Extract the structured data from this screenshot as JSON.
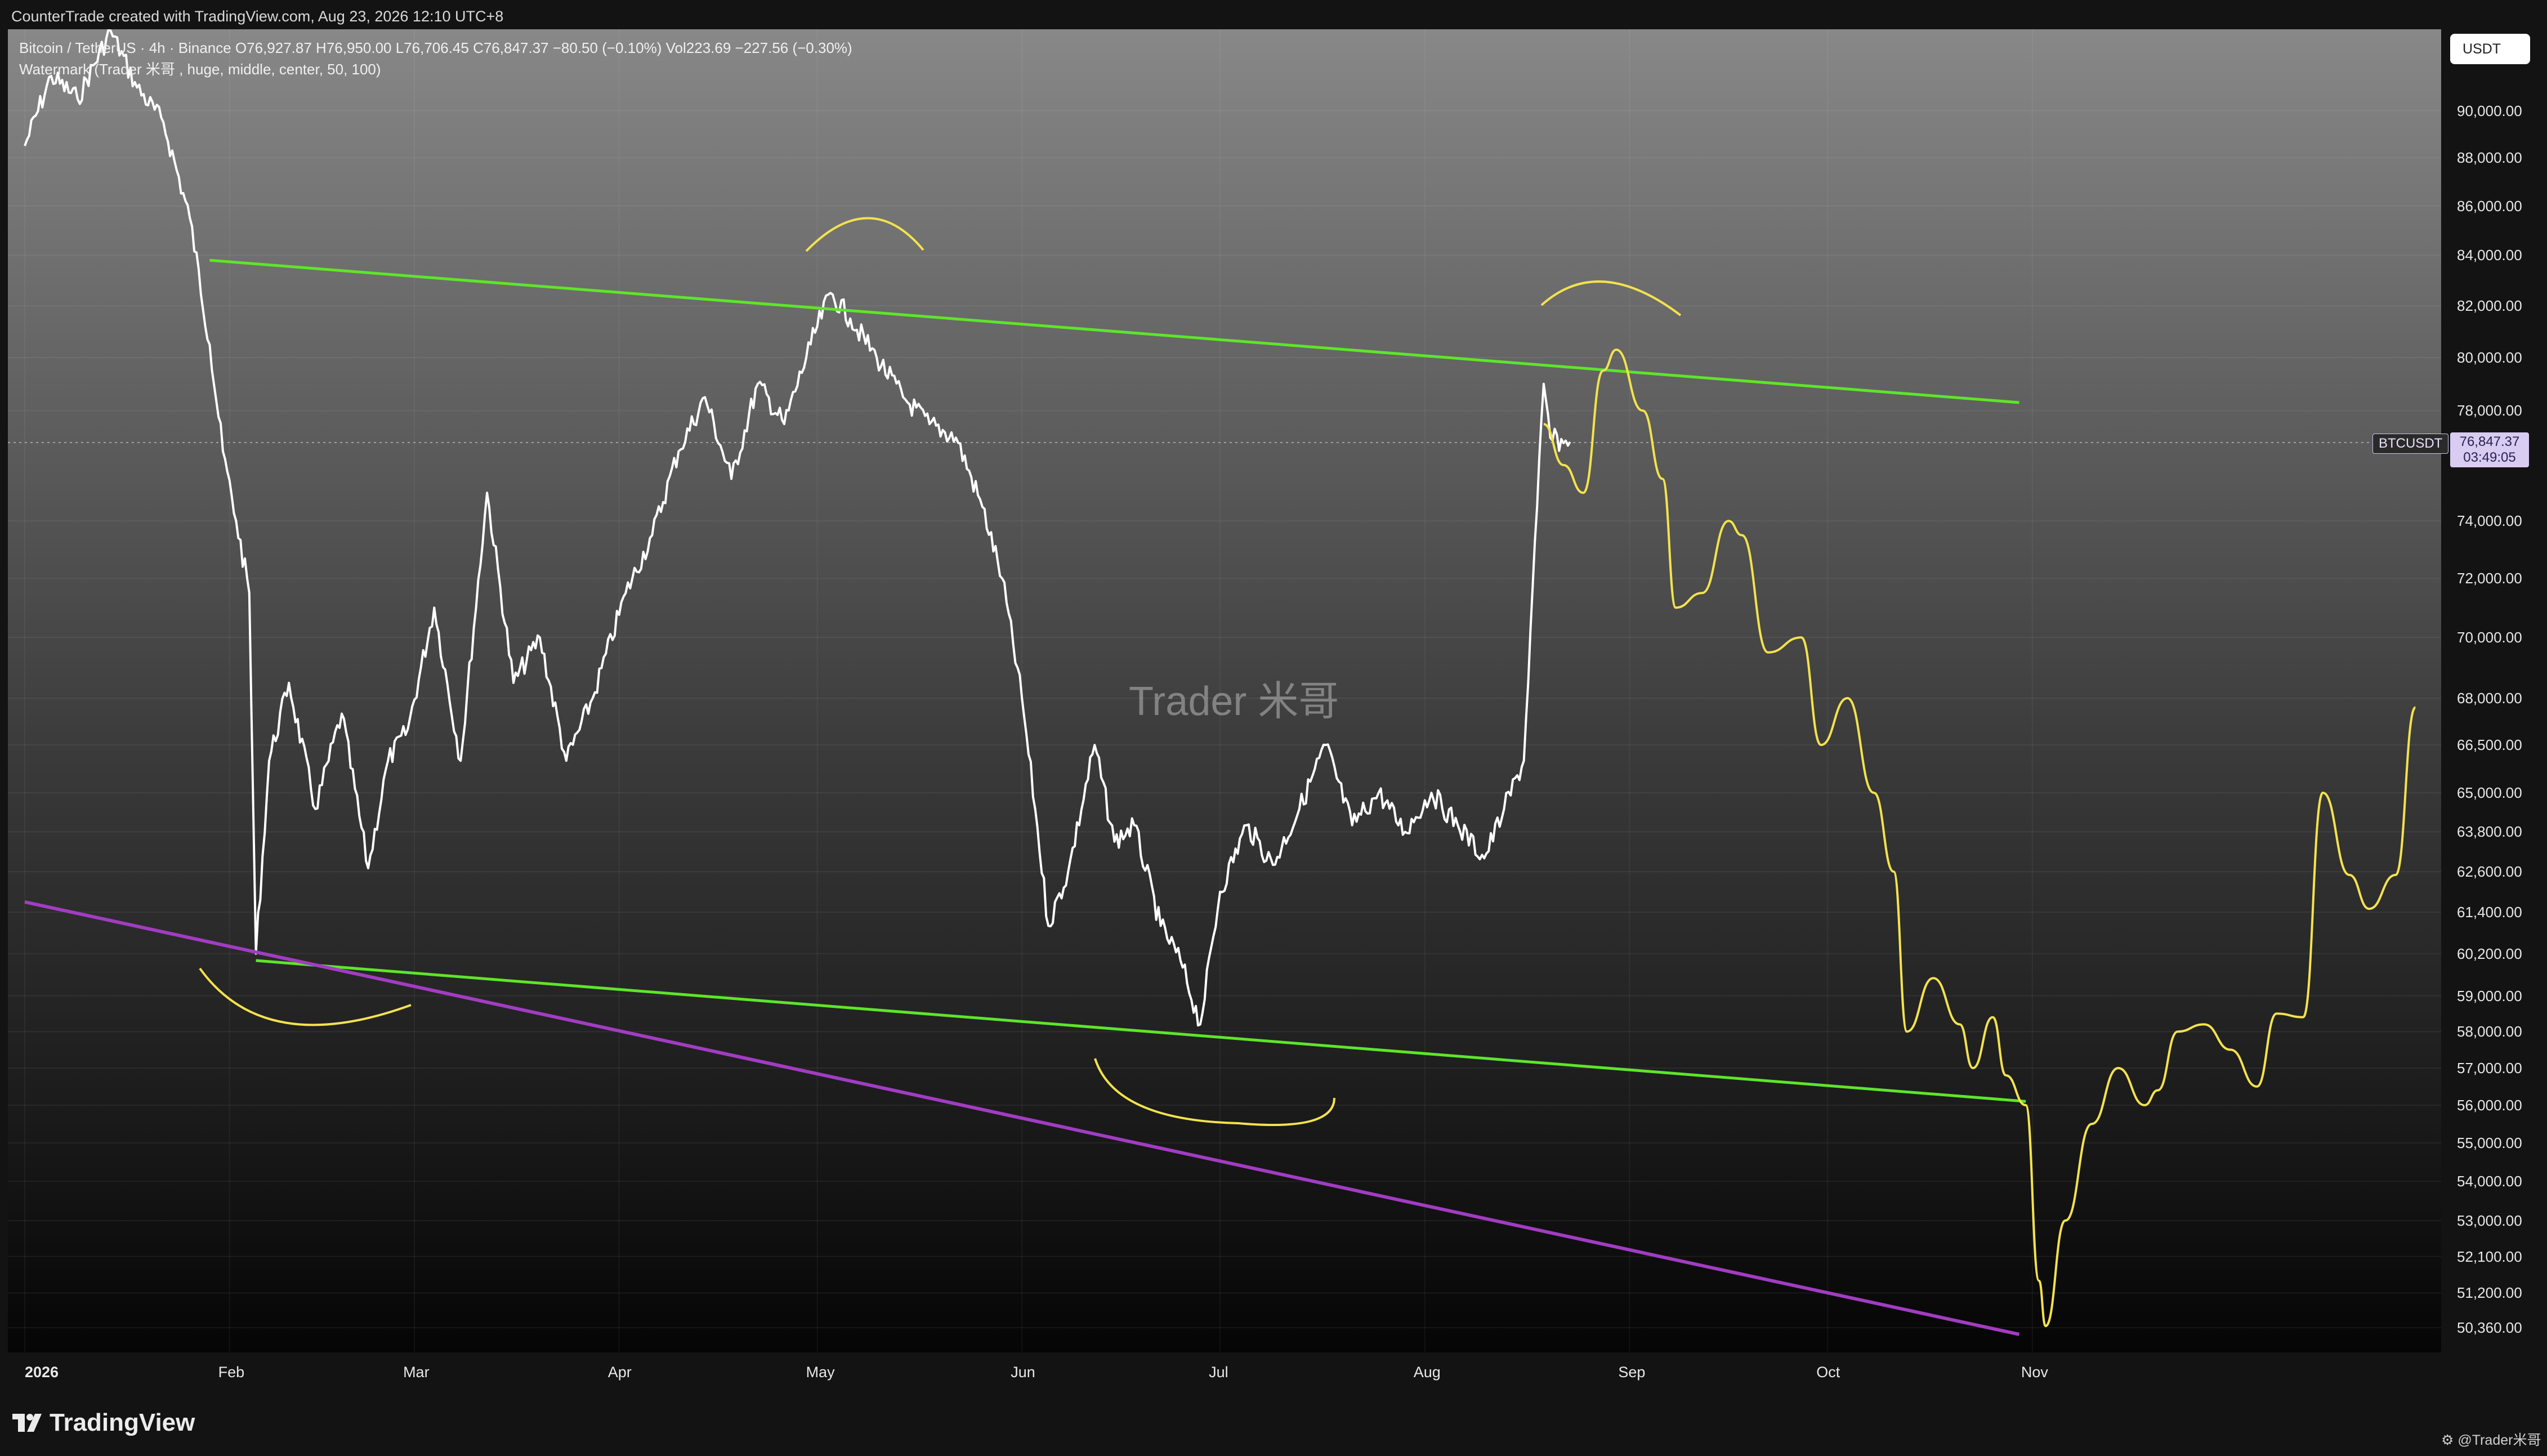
{
  "header": {
    "created_by": "CounterTrade created with TradingView.com, Aug 23, 2026 12:10 UTC+8"
  },
  "legend": {
    "symbol_line": "Bitcoin / TetherUS · 4h · Binance  O76,927.87  H76,950.00  L76,706.45  C76,847.37  −80.50 (−0.10%)  Vol223.69  −227.56 (−0.30%)",
    "indicator_line": "Watermark (Trader 米哥 , huge, middle, center, 50, 100)"
  },
  "toolbar": {
    "currency": "USDT"
  },
  "watermark": {
    "text": "Trader 米哥"
  },
  "price_marker": {
    "symbol": "BTCUSDT",
    "price": "76,847.37",
    "countdown": "03:49:05"
  },
  "brand": {
    "name": "TradingView"
  },
  "credit": {
    "text": "@Trader米哥"
  },
  "colors": {
    "price_line": "#ffffff",
    "green_trendline": "#5ee52a",
    "purple_trendline": "#a23cc2",
    "yellow_drawing": "#f3e24e",
    "marker_bg": "#d8ccf2"
  },
  "icons": [
    "tradingview-logo-icon",
    "snapshot-icon"
  ],
  "chart_data": {
    "type": "line",
    "symbol": "BTCUSDT",
    "interval": "4h",
    "exchange": "Binance",
    "scale": "log",
    "grid": true,
    "ylim": [
      50000,
      95000
    ],
    "xlim": [
      "2026-01-01",
      "2026-12-01"
    ],
    "x_ticks": [
      "2026",
      "Feb",
      "Mar",
      "Apr",
      "May",
      "Jun",
      "Jul",
      "Aug",
      "Sep",
      "Oct",
      "Nov"
    ],
    "y_ticks": [
      "90,000.00",
      "88,000.00",
      "86,000.00",
      "84,000.00",
      "82,000.00",
      "80,000.00",
      "78,000.00",
      "74,000.00",
      "72,000.00",
      "70,000.00",
      "68,000.00",
      "66,500.00",
      "65,000.00",
      "63,800.00",
      "62,600.00",
      "61,400.00",
      "60,200.00",
      "59,000.00",
      "58,000.00",
      "57,000.00",
      "56,000.00",
      "55,000.00",
      "54,000.00",
      "53,000.00",
      "52,100.00",
      "51,200.00",
      "50,360.00"
    ],
    "series": [
      {
        "x": [
          "2026-01-01",
          "2026-01-05",
          "2026-01-09",
          "2026-01-14",
          "2026-01-18",
          "2026-01-22",
          "2026-01-26",
          "2026-01-29",
          "2026-01-31",
          "2026-02-02",
          "2026-02-04",
          "2026-02-05",
          "2026-02-07",
          "2026-02-10",
          "2026-02-14",
          "2026-02-18",
          "2026-02-22",
          "2026-02-25",
          "2026-02-28",
          "2026-03-04",
          "2026-03-08",
          "2026-03-12",
          "2026-03-16",
          "2026-03-20",
          "2026-03-24",
          "2026-03-28",
          "2026-04-02",
          "2026-04-06",
          "2026-04-10",
          "2026-04-14",
          "2026-04-18",
          "2026-04-22",
          "2026-04-26",
          "2026-04-30",
          "2026-05-03",
          "2026-05-06",
          "2026-05-10",
          "2026-05-14",
          "2026-05-18",
          "2026-05-22",
          "2026-05-26",
          "2026-05-29",
          "2026-06-01",
          "2026-06-03",
          "2026-06-05",
          "2026-06-08",
          "2026-06-12",
          "2026-06-15",
          "2026-06-18",
          "2026-06-22",
          "2026-06-25",
          "2026-06-28",
          "2026-07-01",
          "2026-07-05",
          "2026-07-09",
          "2026-07-13",
          "2026-07-17",
          "2026-07-21",
          "2026-07-25",
          "2026-07-29",
          "2026-08-02",
          "2026-08-06",
          "2026-08-10",
          "2026-08-13",
          "2026-08-16",
          "2026-08-18",
          "2026-08-19",
          "2026-08-20",
          "2026-08-22",
          "2026-08-23"
        ],
        "y": [
          88500,
          91500,
          90500,
          93500,
          91000,
          89500,
          85500,
          80500,
          76500,
          74000,
          71500,
          60200,
          66000,
          68500,
          64500,
          67500,
          62700,
          66000,
          67000,
          71000,
          66000,
          75000,
          68500,
          70000,
          66000,
          68000,
          71500,
          73500,
          76500,
          78500,
          75500,
          79000,
          77500,
          80500,
          82500,
          81500,
          80000,
          78500,
          77500,
          77000,
          74500,
          72000,
          68000,
          64500,
          61000,
          62600,
          66500,
          63500,
          64000,
          61000,
          60000,
          58200,
          62000,
          64000,
          62800,
          64500,
          66500,
          64000,
          65000,
          63800,
          65000,
          64000,
          63000,
          64500,
          66000,
          74500,
          79000,
          77000,
          76800,
          76847
        ]
      }
    ],
    "annotations": {
      "green_upper_trendline": [
        [
          "2026-01-29",
          83800
        ],
        [
          "2026-10-30",
          78300
        ]
      ],
      "green_lower_trendline": [
        [
          "2026-02-05",
          60000
        ],
        [
          "2026-10-31",
          56100
        ]
      ],
      "purple_trendline": [
        [
          "2026-01-01",
          61700
        ],
        [
          "2026-10-30",
          50200
        ]
      ],
      "yellow_projection": [
        [
          "2026-08-19",
          77500
        ],
        [
          "2026-08-22",
          76000
        ],
        [
          "2026-08-25",
          75000
        ],
        [
          "2026-08-28",
          79500
        ],
        [
          "2026-08-30",
          80300
        ],
        [
          "2026-09-03",
          78000
        ],
        [
          "2026-09-06",
          75500
        ],
        [
          "2026-09-08",
          71000
        ],
        [
          "2026-09-12",
          71500
        ],
        [
          "2026-09-16",
          74000
        ],
        [
          "2026-09-18",
          73500
        ],
        [
          "2026-09-22",
          69500
        ],
        [
          "2026-09-27",
          70000
        ],
        [
          "2026-09-30",
          66500
        ],
        [
          "2026-10-04",
          68000
        ],
        [
          "2026-10-08",
          65000
        ],
        [
          "2026-10-11",
          62600
        ],
        [
          "2026-10-13",
          58000
        ],
        [
          "2026-10-17",
          59500
        ],
        [
          "2026-10-21",
          58200
        ],
        [
          "2026-10-23",
          57000
        ],
        [
          "2026-10-26",
          58400
        ],
        [
          "2026-10-28",
          56800
        ],
        [
          "2026-10-31",
          56000
        ],
        [
          "2026-11-02",
          51500
        ],
        [
          "2026-11-03",
          50400
        ],
        [
          "2026-11-06",
          53000
        ],
        [
          "2026-11-10",
          55500
        ],
        [
          "2026-11-14",
          57000
        ],
        [
          "2026-11-18",
          56000
        ],
        [
          "2026-11-20",
          56400
        ],
        [
          "2026-11-23",
          58000
        ],
        [
          "2026-11-27",
          58200
        ],
        [
          "2026-12-01",
          57500
        ],
        [
          "2026-12-05",
          56500
        ],
        [
          "2026-12-08",
          58500
        ],
        [
          "2026-12-12",
          58400
        ],
        [
          "2026-12-15",
          65000
        ],
        [
          "2026-12-19",
          62500
        ],
        [
          "2026-12-22",
          61500
        ],
        [
          "2026-12-26",
          62500
        ],
        [
          "2026-12-29",
          67700
        ]
      ]
    }
  }
}
